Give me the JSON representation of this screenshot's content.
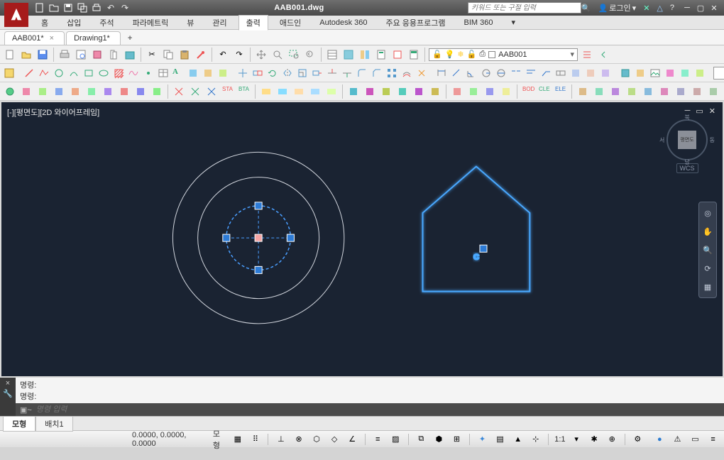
{
  "title": "AAB001.dwg",
  "search_placeholder": "키워드 또는 구절 입력",
  "login": "로그인",
  "ribbon": {
    "tabs": [
      "홈",
      "삽입",
      "주석",
      "파라메트릭",
      "뷰",
      "관리",
      "출력",
      "애드인",
      "Autodesk 360",
      "주요 응용프로그램",
      "BIM 360"
    ],
    "active_index": 6
  },
  "doc_tabs": [
    {
      "label": "AAB001*",
      "active": true
    },
    {
      "label": "Drawing1*",
      "active": false
    }
  ],
  "layer": {
    "name": "AAB001"
  },
  "viewport": {
    "label": "[-][평면도][2D 와이어프레임]"
  },
  "viewcube": {
    "face": "평면도",
    "n": "북",
    "s": "남",
    "e": "동",
    "w": "서"
  },
  "wcs": "WCS",
  "command": {
    "hist1": "명령:",
    "hist2": "명령:",
    "placeholder": "명령 입력",
    "prompt": "▣~"
  },
  "bottom_tabs": [
    {
      "label": "모형",
      "active": true
    },
    {
      "label": "배치1",
      "active": false
    }
  ],
  "status": {
    "coords": "0.0000, 0.0000, 0.0000",
    "space": "모형",
    "scale": "1:1"
  },
  "toolbar_icons": {
    "row1_count": 42,
    "row2_count": 46,
    "row3_count": 48
  }
}
